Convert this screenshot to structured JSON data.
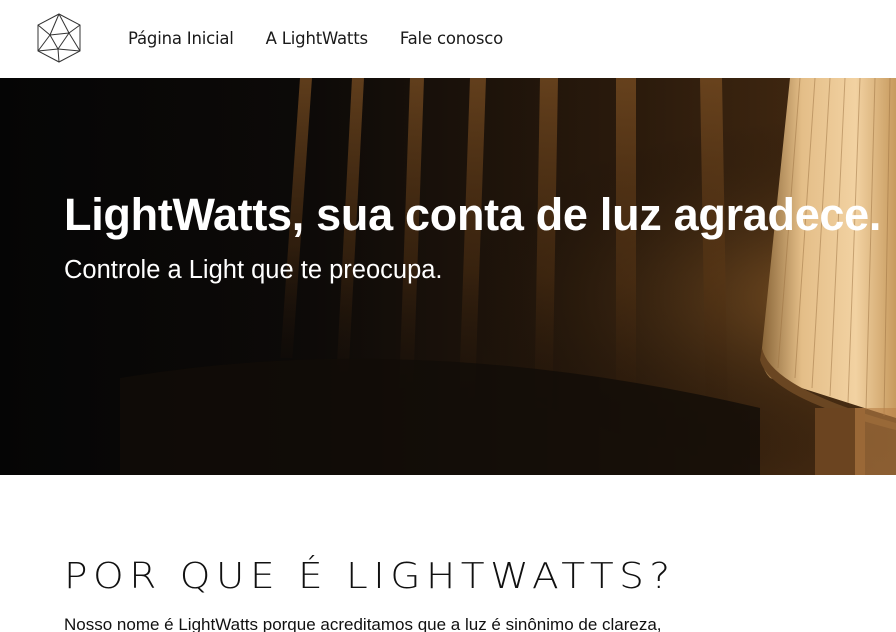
{
  "header": {
    "logo_icon": "geometric-polyhedron-logo",
    "nav": [
      {
        "label": "Página Inicial"
      },
      {
        "label": "A LightWatts"
      },
      {
        "label": "Fale conosco"
      }
    ]
  },
  "hero": {
    "title": "LightWatts, sua conta de luz agradece.",
    "subtitle": "Controle a Light que te preocupa.",
    "background": "dark-room-with-lamp-photo"
  },
  "about": {
    "heading": "POR QUE É LIGHTWATTS?",
    "text": "Nosso nome é LightWatts porque acreditamos que a luz é sinônimo de clareza,"
  },
  "colors": {
    "header_bg": "#ffffff",
    "hero_dark": "#0c0b0b",
    "lamp_glow": "#e2b47a",
    "text": "#111111"
  }
}
